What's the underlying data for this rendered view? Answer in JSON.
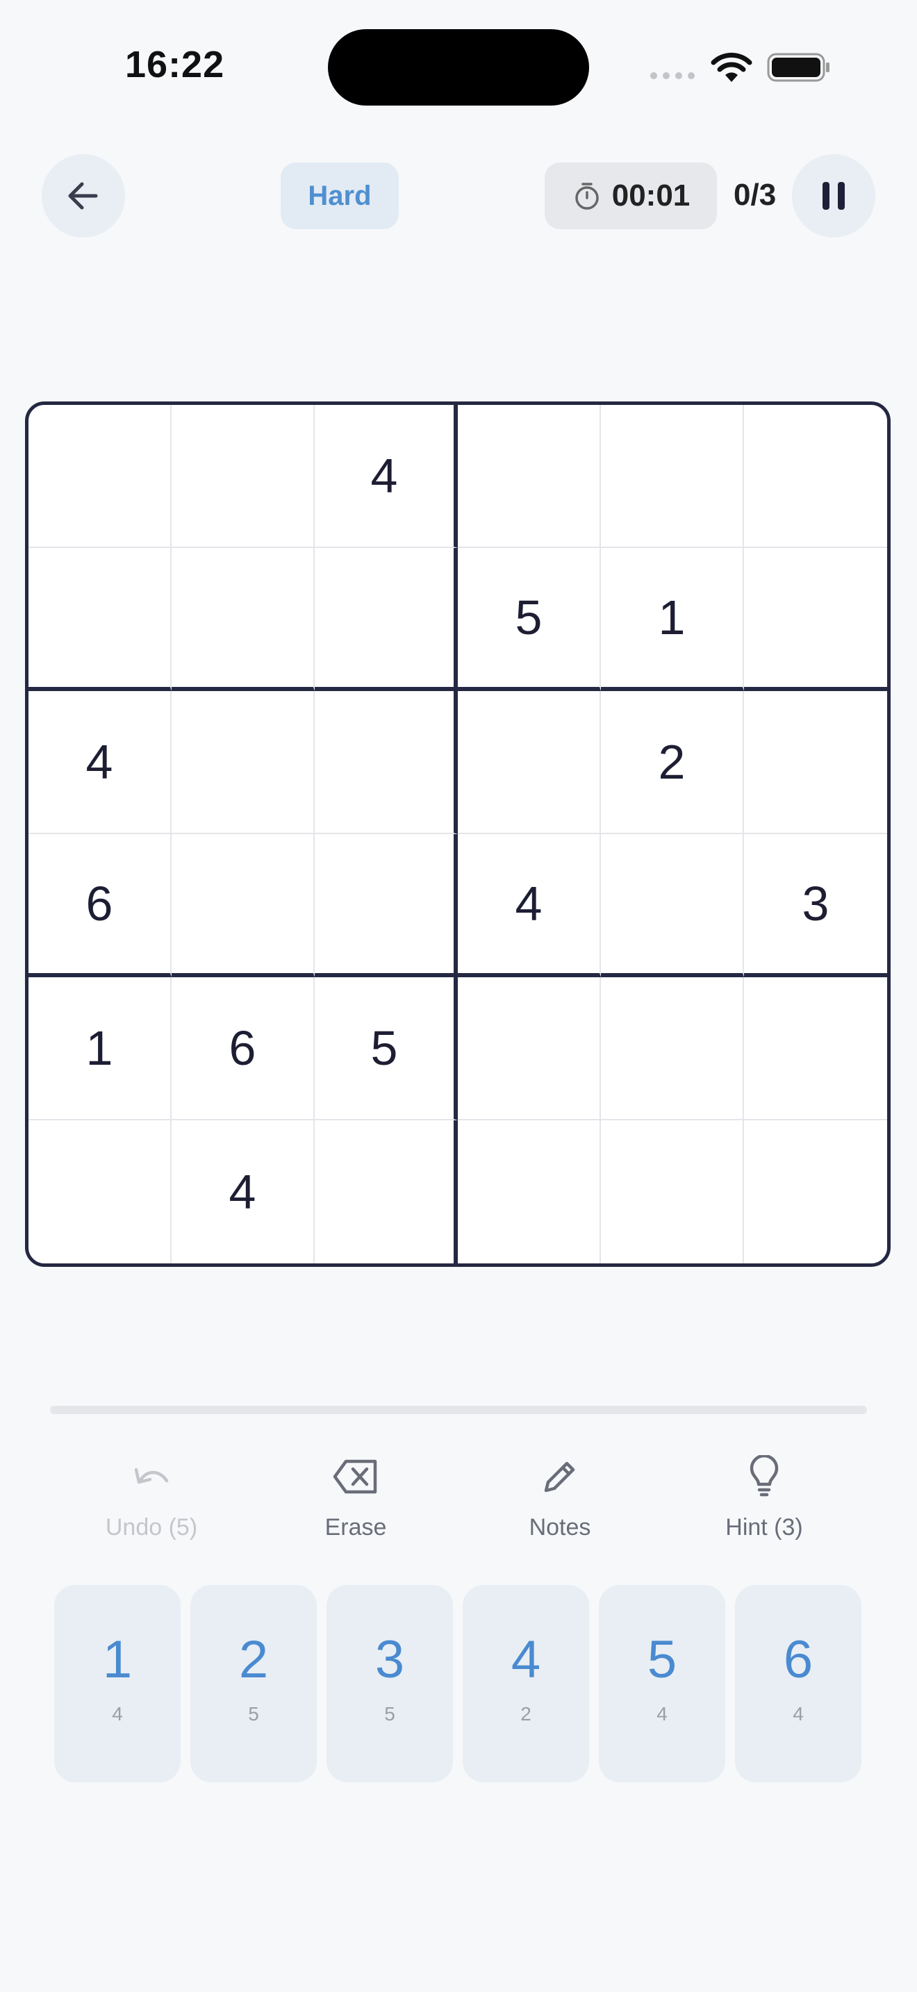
{
  "status_bar": {
    "time": "16:22"
  },
  "header": {
    "difficulty": "Hard",
    "timer": "00:01",
    "mistakes": "0/3"
  },
  "board": {
    "size": 6,
    "cells": [
      [
        "",
        "",
        "4",
        "",
        "",
        ""
      ],
      [
        "",
        "",
        "",
        "5",
        "1",
        ""
      ],
      [
        "4",
        "",
        "",
        "",
        "2",
        ""
      ],
      [
        "6",
        "",
        "",
        "4",
        "",
        "3"
      ],
      [
        "1",
        "6",
        "5",
        "",
        "",
        ""
      ],
      [
        "",
        "4",
        "",
        "",
        "",
        ""
      ]
    ]
  },
  "tools": {
    "undo": {
      "label": "Undo (5)",
      "enabled": false
    },
    "erase": {
      "label": "Erase"
    },
    "notes": {
      "label": "Notes"
    },
    "hint": {
      "label": "Hint (3)"
    }
  },
  "numpad": [
    {
      "digit": "1",
      "count": "4"
    },
    {
      "digit": "2",
      "count": "5"
    },
    {
      "digit": "3",
      "count": "5"
    },
    {
      "digit": "4",
      "count": "2"
    },
    {
      "digit": "5",
      "count": "4"
    },
    {
      "digit": "6",
      "count": "4"
    }
  ],
  "colors": {
    "accent": "#4a8ad0",
    "board_border": "#252842",
    "background": "#f6f8fa"
  }
}
